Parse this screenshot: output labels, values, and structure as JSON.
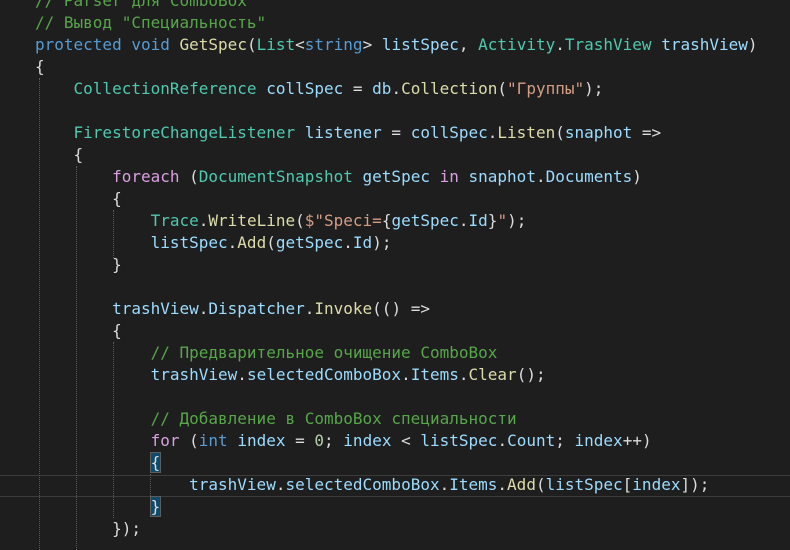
{
  "editor": {
    "theme_colors": {
      "background": "#1e1e1e",
      "comment": "#57a64a",
      "keyword": "#569cd6",
      "type": "#4ec9b0",
      "method": "#dcdcaa",
      "variable": "#9cdcfe",
      "string": "#d69d85",
      "number": "#b5cea8",
      "control": "#d8a0df",
      "plain": "#dcdcdc"
    },
    "lines": [
      [
        {
          "t": "// Parser для ComboBox",
          "c": "comment"
        }
      ],
      [
        {
          "t": "// Вывод \"Специальность\"",
          "c": "comment"
        }
      ],
      [
        {
          "t": "protected",
          "c": "kw"
        },
        {
          "t": " ",
          "c": "plain"
        },
        {
          "t": "void",
          "c": "kw"
        },
        {
          "t": " ",
          "c": "plain"
        },
        {
          "t": "GetSpec",
          "c": "method"
        },
        {
          "t": "(",
          "c": "plain"
        },
        {
          "t": "List",
          "c": "type"
        },
        {
          "t": "<",
          "c": "plain"
        },
        {
          "t": "string",
          "c": "kw"
        },
        {
          "t": "> ",
          "c": "plain"
        },
        {
          "t": "listSpec",
          "c": "var"
        },
        {
          "t": ", ",
          "c": "plain"
        },
        {
          "t": "Activity",
          "c": "type"
        },
        {
          "t": ".",
          "c": "plain"
        },
        {
          "t": "TrashView",
          "c": "type"
        },
        {
          "t": " ",
          "c": "plain"
        },
        {
          "t": "trashView",
          "c": "var"
        },
        {
          "t": ")",
          "c": "plain"
        }
      ],
      [
        {
          "t": "{",
          "c": "plain"
        }
      ],
      [
        {
          "t": "    ",
          "c": "plain"
        },
        {
          "t": "CollectionReference",
          "c": "type"
        },
        {
          "t": " ",
          "c": "plain"
        },
        {
          "t": "collSpec",
          "c": "var"
        },
        {
          "t": " = ",
          "c": "plain"
        },
        {
          "t": "db",
          "c": "var"
        },
        {
          "t": ".",
          "c": "plain"
        },
        {
          "t": "Collection",
          "c": "method"
        },
        {
          "t": "(",
          "c": "plain"
        },
        {
          "t": "\"Группы\"",
          "c": "str"
        },
        {
          "t": ");",
          "c": "plain"
        }
      ],
      [],
      [
        {
          "t": "    ",
          "c": "plain"
        },
        {
          "t": "FirestoreChangeListener",
          "c": "type"
        },
        {
          "t": " ",
          "c": "plain"
        },
        {
          "t": "listener",
          "c": "var"
        },
        {
          "t": " = ",
          "c": "plain"
        },
        {
          "t": "collSpec",
          "c": "var"
        },
        {
          "t": ".",
          "c": "plain"
        },
        {
          "t": "Listen",
          "c": "method"
        },
        {
          "t": "(",
          "c": "plain"
        },
        {
          "t": "snaphot",
          "c": "var"
        },
        {
          "t": " =>",
          "c": "plain"
        }
      ],
      [
        {
          "t": "    {",
          "c": "plain"
        }
      ],
      [
        {
          "t": "        ",
          "c": "plain"
        },
        {
          "t": "foreach",
          "c": "ctrl"
        },
        {
          "t": " (",
          "c": "plain"
        },
        {
          "t": "DocumentSnapshot",
          "c": "type"
        },
        {
          "t": " ",
          "c": "plain"
        },
        {
          "t": "getSpec",
          "c": "var"
        },
        {
          "t": " ",
          "c": "plain"
        },
        {
          "t": "in",
          "c": "ctrl"
        },
        {
          "t": " ",
          "c": "plain"
        },
        {
          "t": "snaphot",
          "c": "var"
        },
        {
          "t": ".",
          "c": "plain"
        },
        {
          "t": "Documents",
          "c": "var"
        },
        {
          "t": ")",
          "c": "plain"
        }
      ],
      [
        {
          "t": "        {",
          "c": "plain"
        }
      ],
      [
        {
          "t": "            ",
          "c": "plain"
        },
        {
          "t": "Trace",
          "c": "type"
        },
        {
          "t": ".",
          "c": "plain"
        },
        {
          "t": "WriteLine",
          "c": "method"
        },
        {
          "t": "(",
          "c": "plain"
        },
        {
          "t": "$\"",
          "c": "str"
        },
        {
          "t": "Speci=",
          "c": "str"
        },
        {
          "t": "{",
          "c": "plain"
        },
        {
          "t": "getSpec",
          "c": "var"
        },
        {
          "t": ".",
          "c": "plain"
        },
        {
          "t": "Id",
          "c": "var"
        },
        {
          "t": "}",
          "c": "plain"
        },
        {
          "t": "\"",
          "c": "str"
        },
        {
          "t": ");",
          "c": "plain"
        }
      ],
      [
        {
          "t": "            ",
          "c": "plain"
        },
        {
          "t": "listSpec",
          "c": "var"
        },
        {
          "t": ".",
          "c": "plain"
        },
        {
          "t": "Add",
          "c": "method"
        },
        {
          "t": "(",
          "c": "plain"
        },
        {
          "t": "getSpec",
          "c": "var"
        },
        {
          "t": ".",
          "c": "plain"
        },
        {
          "t": "Id",
          "c": "var"
        },
        {
          "t": ");",
          "c": "plain"
        }
      ],
      [
        {
          "t": "        }",
          "c": "plain"
        }
      ],
      [],
      [
        {
          "t": "        ",
          "c": "plain"
        },
        {
          "t": "trashView",
          "c": "var"
        },
        {
          "t": ".",
          "c": "plain"
        },
        {
          "t": "Dispatcher",
          "c": "var"
        },
        {
          "t": ".",
          "c": "plain"
        },
        {
          "t": "Invoke",
          "c": "method"
        },
        {
          "t": "(() =>",
          "c": "plain"
        }
      ],
      [
        {
          "t": "        {",
          "c": "plain"
        }
      ],
      [
        {
          "t": "            ",
          "c": "plain"
        },
        {
          "t": "// Предварительное очищение ComboBox",
          "c": "comment"
        }
      ],
      [
        {
          "t": "            ",
          "c": "plain"
        },
        {
          "t": "trashView",
          "c": "var"
        },
        {
          "t": ".",
          "c": "plain"
        },
        {
          "t": "selectedComboBox",
          "c": "var"
        },
        {
          "t": ".",
          "c": "plain"
        },
        {
          "t": "Items",
          "c": "var"
        },
        {
          "t": ".",
          "c": "plain"
        },
        {
          "t": "Clear",
          "c": "method"
        },
        {
          "t": "();",
          "c": "plain"
        }
      ],
      [],
      [
        {
          "t": "            ",
          "c": "plain"
        },
        {
          "t": "// Добавление в ComboBox специальности",
          "c": "comment"
        }
      ],
      [
        {
          "t": "            ",
          "c": "plain"
        },
        {
          "t": "for",
          "c": "ctrl"
        },
        {
          "t": " (",
          "c": "plain"
        },
        {
          "t": "int",
          "c": "kw"
        },
        {
          "t": " ",
          "c": "plain"
        },
        {
          "t": "index",
          "c": "var"
        },
        {
          "t": " = ",
          "c": "plain"
        },
        {
          "t": "0",
          "c": "num"
        },
        {
          "t": "; ",
          "c": "plain"
        },
        {
          "t": "index",
          "c": "var"
        },
        {
          "t": " < ",
          "c": "plain"
        },
        {
          "t": "listSpec",
          "c": "var"
        },
        {
          "t": ".",
          "c": "plain"
        },
        {
          "t": "Count",
          "c": "var"
        },
        {
          "t": "; ",
          "c": "plain"
        },
        {
          "t": "index",
          "c": "var"
        },
        {
          "t": "++)",
          "c": "plain"
        }
      ],
      [
        {
          "t": "            ",
          "c": "plain"
        },
        {
          "t": "{",
          "c": "brace"
        }
      ],
      [
        {
          "t": "                ",
          "c": "plain"
        },
        {
          "t": "trashView",
          "c": "var"
        },
        {
          "t": ".",
          "c": "plain"
        },
        {
          "t": "selectedComboBox",
          "c": "var"
        },
        {
          "t": ".",
          "c": "plain"
        },
        {
          "t": "Items",
          "c": "var"
        },
        {
          "t": ".",
          "c": "plain"
        },
        {
          "t": "Add",
          "c": "method"
        },
        {
          "t": "(",
          "c": "plain"
        },
        {
          "t": "listSpec",
          "c": "var"
        },
        {
          "t": "[",
          "c": "plain"
        },
        {
          "t": "index",
          "c": "var"
        },
        {
          "t": "]);",
          "c": "plain"
        }
      ],
      [
        {
          "t": "            ",
          "c": "plain"
        },
        {
          "t": "}",
          "c": "brace"
        }
      ],
      [
        {
          "t": "        });",
          "c": "plain"
        }
      ],
      []
    ]
  }
}
